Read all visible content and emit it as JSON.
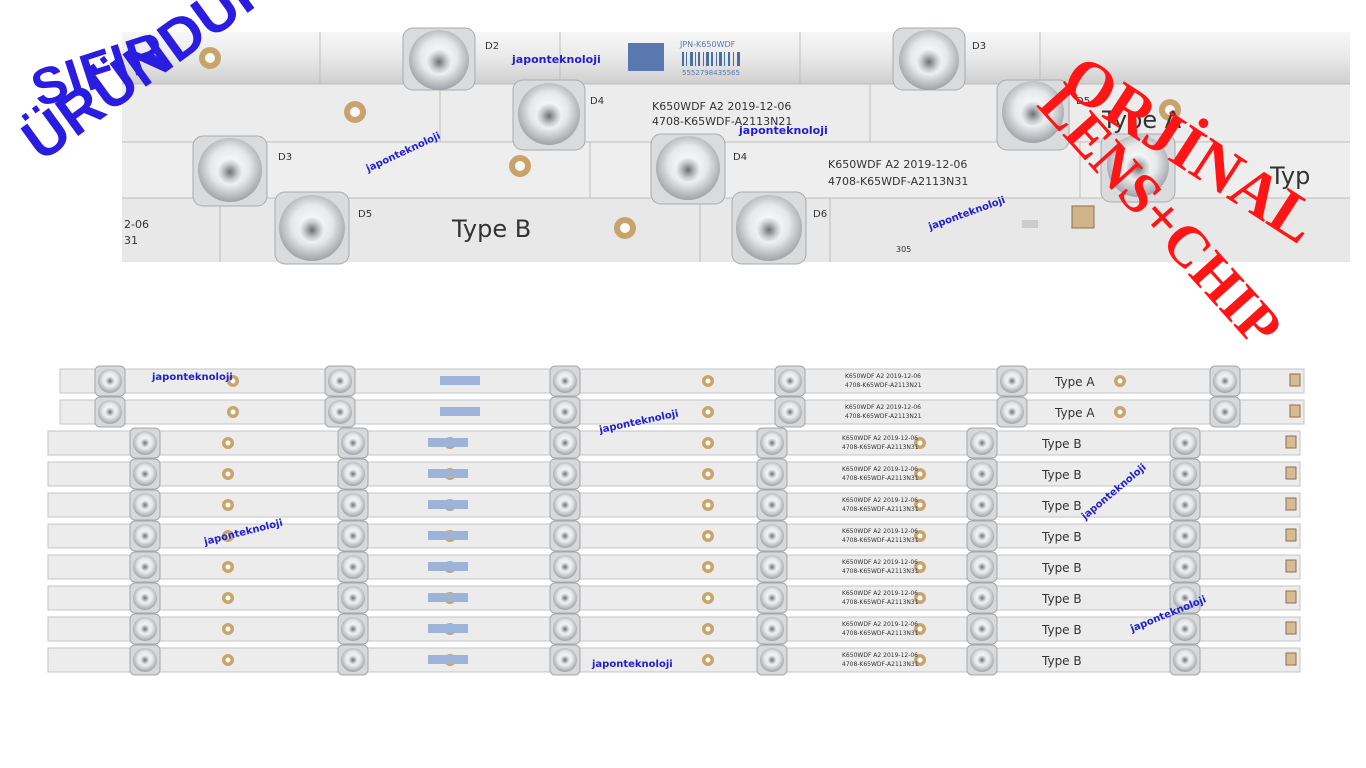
{
  "overlay": {
    "top_left_line1": "SIFIR",
    "top_left_line2": "ÜRÜNDÜR",
    "top_right_line1": "ORJİNAL",
    "top_right_line2": "LENS+CHIP",
    "blue": "#2a1ce0",
    "red": "#ff1515"
  },
  "watermark": "japonteknoloji",
  "closeup": {
    "strip_a_code": "K650WDF  A2  2019-12-06",
    "strip_a_part": "4708-K65WDF-A2113N21",
    "strip_b_code": "K650WDF  A2  2019-12-06",
    "strip_b_part": "4708-K65WDF-A2113N31",
    "sticker": "JPN-K650WDF",
    "barcode_number": "5552798435565",
    "type_a_fragment": "Type A",
    "type_b": "Type B",
    "type_right_fragment": "Typ",
    "left_date_fragment": "2-06",
    "left_part_fragment": "31",
    "board_number": "305",
    "labels": [
      "D2",
      "D3",
      "D4",
      "D5",
      "D3",
      "D4",
      "D5",
      "D6"
    ]
  },
  "strips": {
    "code": "K650WDF  A2  2019-12-06",
    "part_a": "4708-K65WDF-A2113N21",
    "part_b": "4708-K65WDF-A2113N31",
    "types": [
      "Type A",
      "Type A",
      "Type B",
      "Type B",
      "Type B",
      "Type B",
      "Type B",
      "Type B",
      "Type B",
      "Type B"
    ]
  }
}
